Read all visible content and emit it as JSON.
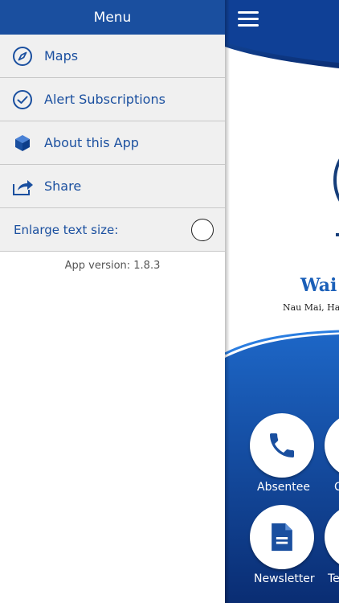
{
  "drawer": {
    "title": "Menu",
    "items": [
      {
        "label": "Maps",
        "icon": "compass-icon"
      },
      {
        "label": "Alert Subscriptions",
        "icon": "check-circle-icon"
      },
      {
        "label": "About this App",
        "icon": "cube-icon"
      },
      {
        "label": "Share",
        "icon": "share-icon"
      }
    ],
    "enlarge_label": "Enlarge text size:",
    "enlarge_enabled": false,
    "version": "App version: 1.8.3"
  },
  "app": {
    "school_name_visible": "Wai",
    "welcome_visible": "Nau Mai, Hae",
    "tiles": [
      {
        "label": "Absentee",
        "icon": "phone-icon"
      },
      {
        "label": "C",
        "icon": "partial-icon"
      },
      {
        "label": "Newsletter",
        "icon": "document-icon"
      },
      {
        "label": "Te",
        "icon": "partial-icon"
      }
    ]
  },
  "colors": {
    "brand_blue": "#1a4f9f",
    "dark_blue": "#0d3d8a",
    "menu_bg": "#f0f0f0"
  }
}
